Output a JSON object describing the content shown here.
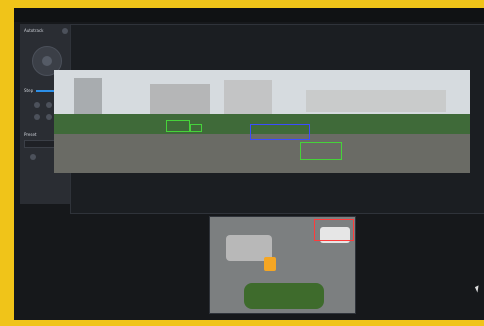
{
  "app": {
    "sidebar": {
      "title": "Autotrack",
      "preset_label": "Preset",
      "step_label": "Step"
    },
    "panorama": {
      "timestamp": ""
    },
    "subview": {
      "timestamp": ""
    },
    "colors": {
      "accent_yellow": "#f0c419",
      "panel_dark": "#16181b",
      "sidebar": "#2a2d33",
      "highlight_blue": "#2c8fe8",
      "box_green": "#46d33a",
      "box_blue": "#3b4cff",
      "box_red": "#ff3b3b"
    },
    "icons": [
      "joystick-icon",
      "dot-icon",
      "cursor-icon"
    ]
  }
}
